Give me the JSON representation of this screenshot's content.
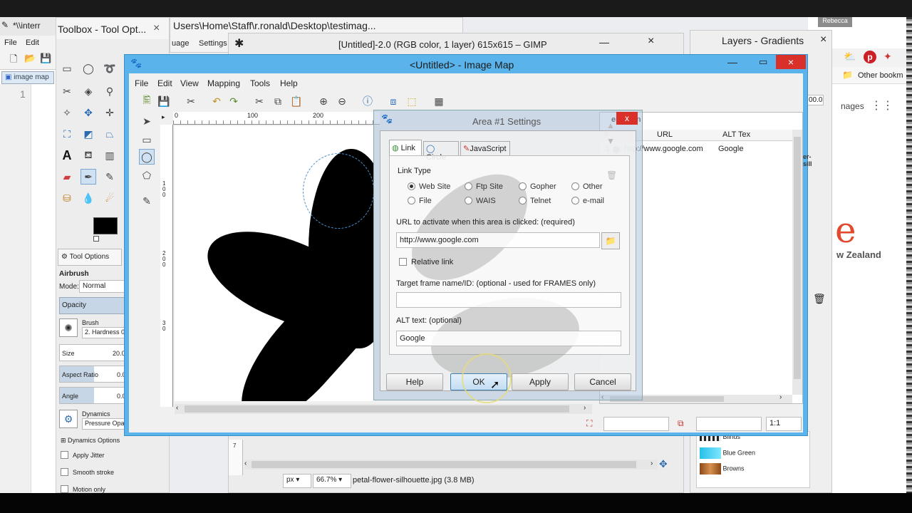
{
  "notepad": {
    "title": "*\\\\interr",
    "menu": [
      "File",
      "Edit"
    ],
    "tab": "image map",
    "line": "1"
  },
  "toolbox": {
    "title": "Toolbox - Tool Opt...",
    "close": "×",
    "tab": "Tool Options",
    "tool": "Airbrush",
    "mode_label": "Mode:",
    "mode": "Normal",
    "opacity": "Opacity",
    "brush_label": "Brush",
    "brush": "2. Hardness 0",
    "size_label": "Size",
    "size": "20.0",
    "ratio_label": "Aspect Ratio",
    "ratio": "0.0",
    "angle_label": "Angle",
    "angle": "0.0",
    "dynamics_label": "Dynamics",
    "dynamics": "Pressure Opa",
    "dyn_options": "Dynamics Options",
    "jitter": "Apply Jitter",
    "smooth": "Smooth stroke",
    "motion": "Motion only"
  },
  "explorer": {
    "path": "Users\\Home\\Staff\\r.ronald\\Desktop\\testimag...",
    "menu": [
      "uage",
      "Settings"
    ]
  },
  "gimp": {
    "title": "[Untitled]-2.0 (RGB color, 1 layer) 615x615 – GIMP",
    "unit": "px",
    "zoom": "66.7%",
    "file": "petal-flower-silhouette.jpg (3.8 MB)"
  },
  "layers": {
    "title": "Layers - Gradients",
    "zoom": "00.0",
    "gradients": [
      "Blinds",
      "Blue Green",
      "Browns"
    ]
  },
  "browser": {
    "user": "Rebecca",
    "bookmarks": "Other bookm",
    "images": "nages",
    "brand": "e",
    "country": "w Zealand"
  },
  "imagemap": {
    "title": "<Untitled> - Image Map",
    "menu": [
      "File",
      "Edit",
      "View",
      "Mapping",
      "Tools",
      "Help"
    ],
    "ruler": [
      "0",
      "100",
      "200"
    ],
    "vruler": [
      "1",
      "0",
      "0",
      "2",
      "0",
      "0",
      "3",
      "0"
    ],
    "selection": "election",
    "col_num": "#",
    "col_url": "URL",
    "col_alt": "ALT Tex",
    "row": {
      "num": "1",
      "url": "http://www.google.com",
      "alt": "Google"
    },
    "side_text": "er-sill",
    "zoom": "1:1"
  },
  "dialog": {
    "title": "Area #1 Settings",
    "close": "x",
    "tabs": [
      "Link",
      "Circle",
      "JavaScript"
    ],
    "link_type": "Link Type",
    "types": [
      "Web Site",
      "Ftp Site",
      "Gopher",
      "Other",
      "File",
      "WAIS",
      "Telnet",
      "e-mail"
    ],
    "url_label": "URL to activate when this area is clicked: (required)",
    "url": "http://www.google.com",
    "relative": "Relative link",
    "target_label": "Target frame name/ID: (optional - used for FRAMES only)",
    "target": "",
    "alt_label": "ALT text: (optional)",
    "alt": "Google",
    "help": "Help",
    "ok": "OK",
    "apply": "Apply",
    "cancel": "Cancel"
  },
  "colors": {
    "win_border": "#4aa3df",
    "close": "#d9302a",
    "titlebar": "#5ab3ea"
  }
}
